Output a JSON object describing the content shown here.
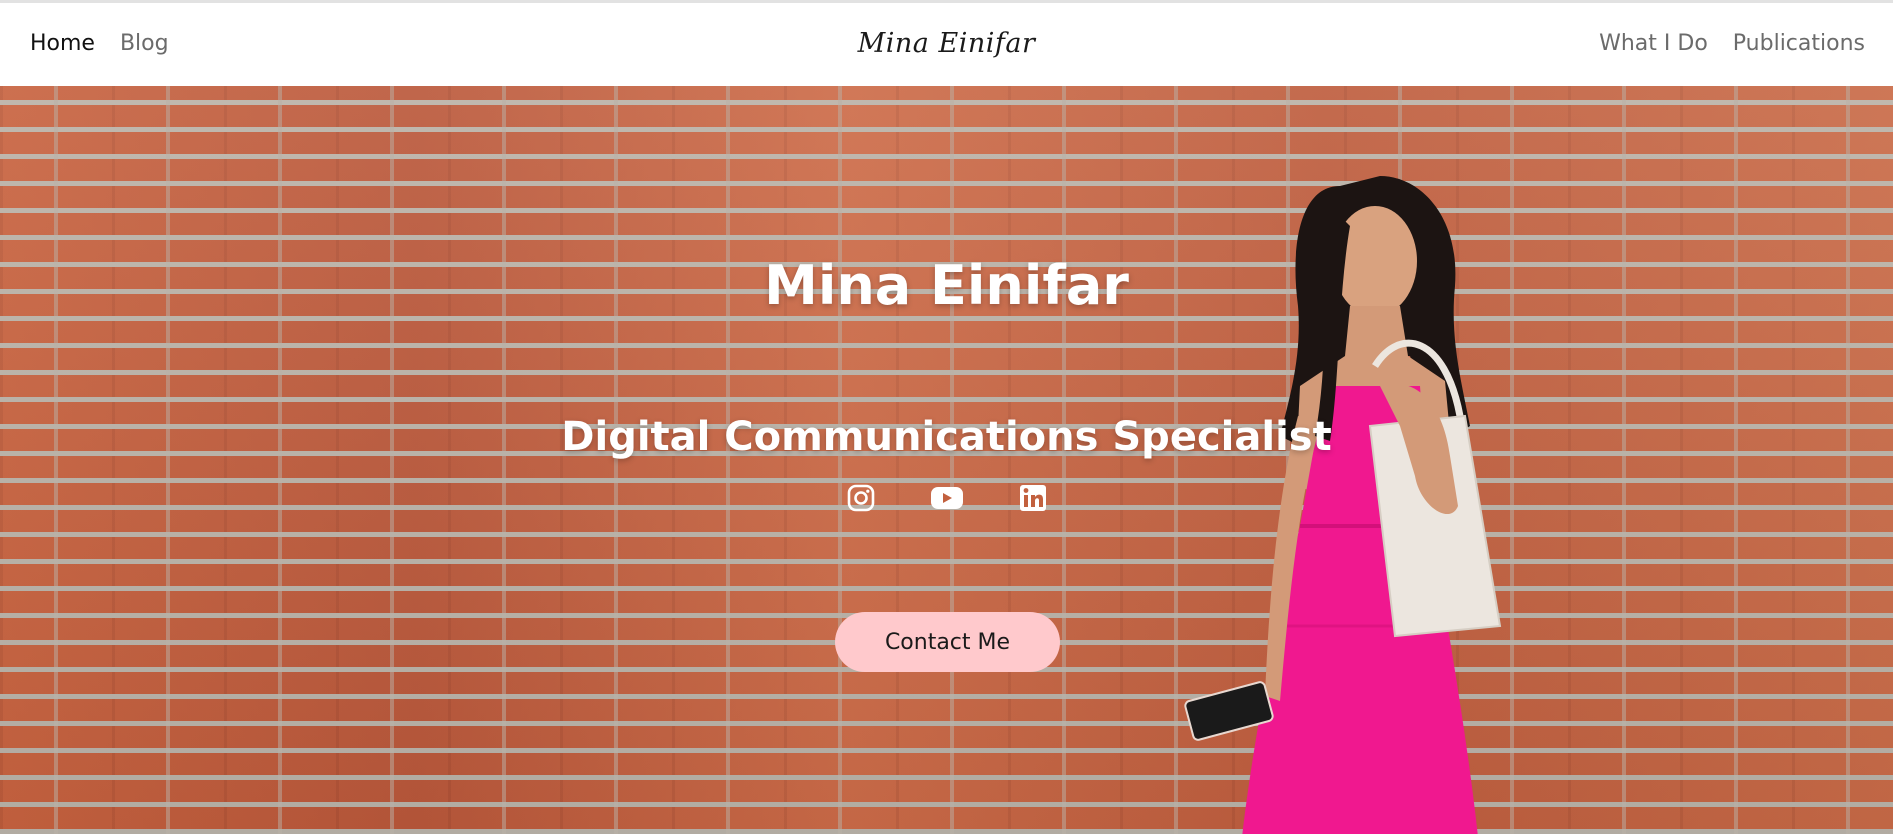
{
  "nav": {
    "left_links": [
      {
        "label": "Home",
        "active": true
      },
      {
        "label": "Blog",
        "active": false
      }
    ],
    "brand": "Mina Einifar",
    "right_links": [
      {
        "label": "What I Do"
      },
      {
        "label": "Publications"
      }
    ]
  },
  "hero": {
    "title": "Mina Einifar",
    "subtitle": "Digital Communications Specialist",
    "social_icons": [
      "instagram-icon",
      "youtube-icon",
      "linkedin-icon"
    ],
    "cta_label": "Contact Me"
  },
  "colors": {
    "cta_background": "#ffc9cc",
    "brick": "#c2603e",
    "dress": "#f0188f",
    "text_dark": "#111111",
    "nav_text": "#6b6b6b"
  }
}
